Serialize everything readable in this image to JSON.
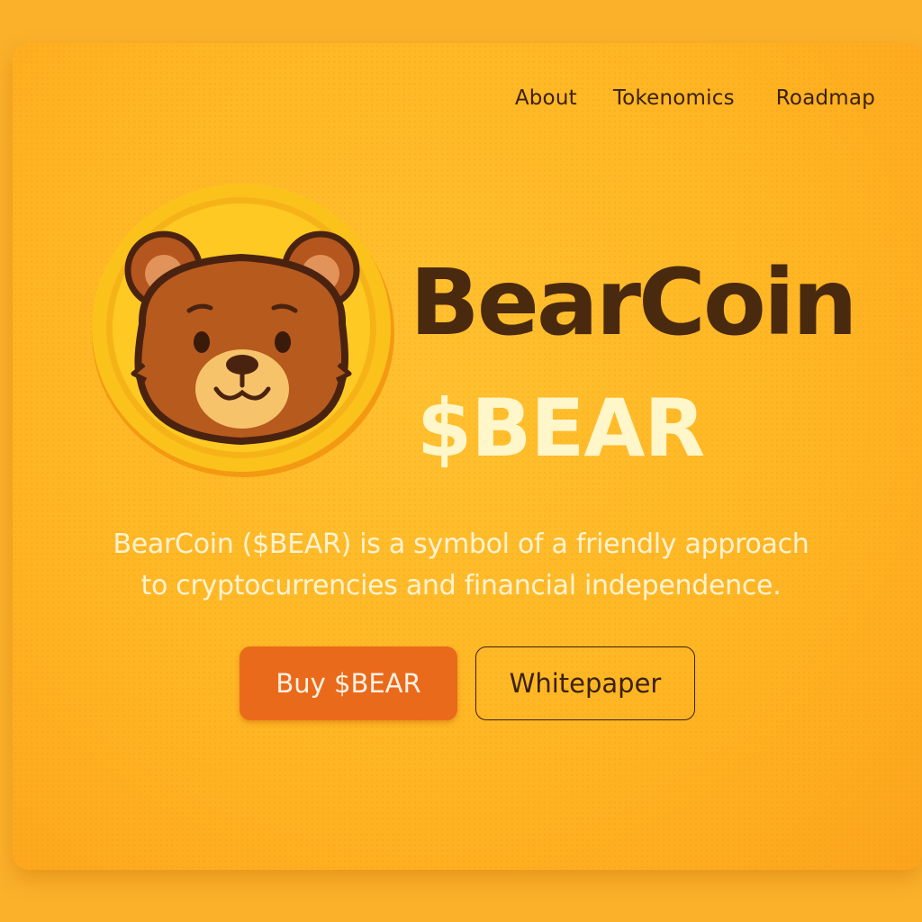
{
  "nav": {
    "items": [
      {
        "label": "About"
      },
      {
        "label": "Tokenomics"
      },
      {
        "label": "Roadmap"
      }
    ]
  },
  "hero": {
    "title": "BearCoin",
    "ticker": "$BEAR",
    "description_line1": "BearCoin ($BEAR) is a symbol of a friendly approach",
    "description_line2": "to cryptocurrencies and financial independence.",
    "logo_icon": "bear-coin-logo"
  },
  "buttons": {
    "buy_label": "Buy $BEAR",
    "whitepaper_label": "Whitepaper"
  },
  "colors": {
    "background": "#fbb12a",
    "title": "#4a2a0f",
    "ticker": "#fff6c9",
    "buy_button": "#ea6a1c",
    "text_dark": "#3a210c"
  }
}
